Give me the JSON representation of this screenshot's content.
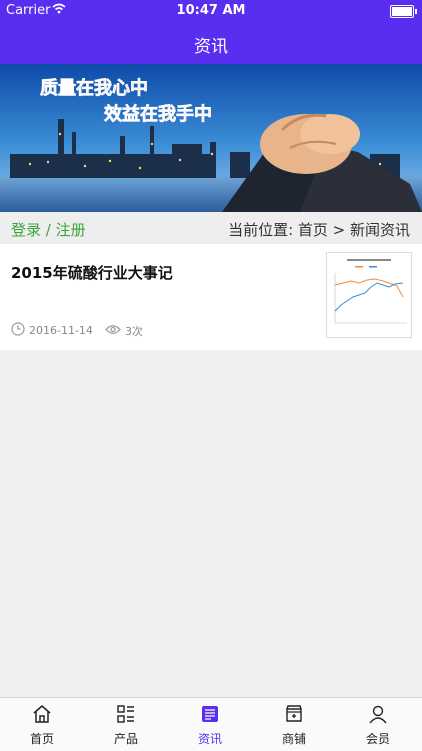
{
  "status_bar": {
    "carrier": "Carrier",
    "time": "10:47 AM"
  },
  "navbar": {
    "title": "资讯"
  },
  "banner": {
    "slogan_line1": "质量在我心中",
    "slogan_line2": "效益在我手中"
  },
  "breadcrumb": {
    "login_label": "登录 / 注册",
    "location": "当前位置: 首页 > 新闻资讯"
  },
  "news": [
    {
      "title": "2015年硫酸行业大事记",
      "date": "2016-11-14",
      "views": "3次"
    }
  ],
  "tabbar": {
    "items": [
      {
        "label": "首页",
        "icon": "home-icon"
      },
      {
        "label": "产品",
        "icon": "grid-list-icon"
      },
      {
        "label": "资讯",
        "icon": "news-icon"
      },
      {
        "label": "商铺",
        "icon": "store-icon"
      },
      {
        "label": "会员",
        "icon": "user-icon"
      }
    ],
    "active_index": 2
  },
  "colors": {
    "brand": "#5a2ef0",
    "login": "#3aa53a"
  }
}
